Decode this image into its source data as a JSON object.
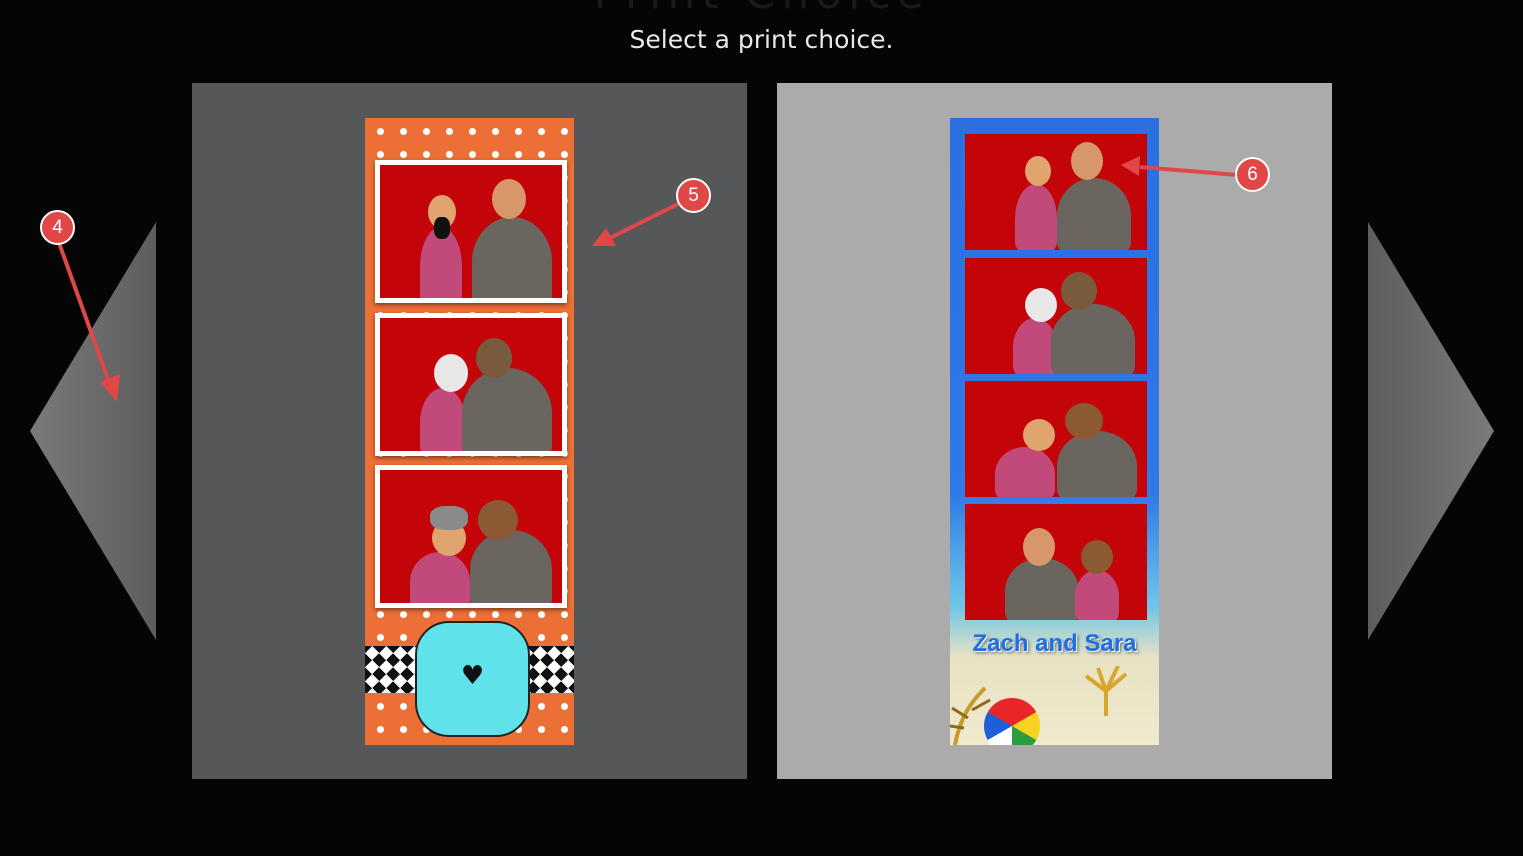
{
  "header": {
    "title_partial": "Print Choice",
    "subtitle": "Select a print choice."
  },
  "navigation": {
    "prev_icon": "triangle-left-icon",
    "next_icon": "triangle-right-icon"
  },
  "choices": [
    {
      "layout": "3 photos",
      "theme_color": "#ec6f36",
      "card_color": "#565758",
      "footer_icon": "heart-with-arrow-icon",
      "footer_glyph": "♥"
    },
    {
      "layout": "4 photos",
      "theme_color": "#2b6fe0",
      "card_color": "#ababac",
      "footer_text": "Zach and Sara"
    }
  ],
  "annotations": [
    {
      "label": "4"
    },
    {
      "label": "5"
    },
    {
      "label": "6"
    }
  ],
  "colors": {
    "background": "#050505",
    "callout": "#e04848",
    "photo_backdrop": "#c30409"
  }
}
